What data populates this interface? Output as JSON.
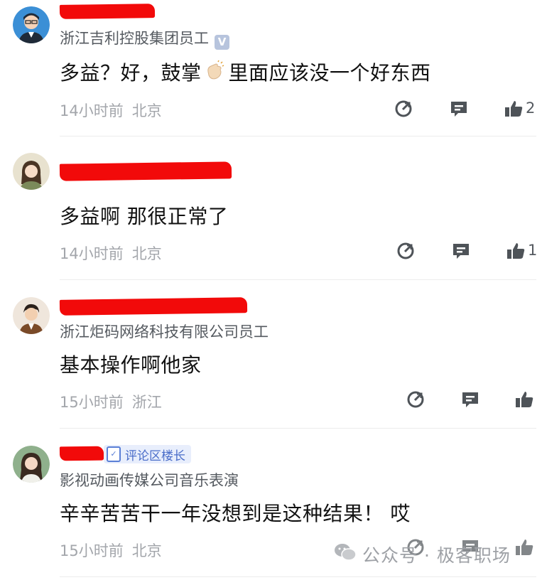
{
  "comments": [
    {
      "company": "浙江吉利控股集团员工",
      "verified": true,
      "text": "多益？好，鼓掌",
      "text_after_emoji": "里面应该没一个好东西",
      "time": "14小时前",
      "location": "北京",
      "likes": "2"
    },
    {
      "company": "",
      "verified": false,
      "text": "多益啊 那很正常了",
      "time": "14小时前",
      "location": "北京",
      "likes": "1"
    },
    {
      "company": "浙江炬码网络科技有限公司员工",
      "verified": false,
      "text": "基本操作啊他家",
      "time": "15小时前",
      "location": "浙江",
      "likes": ""
    },
    {
      "company": "影视动画传媒公司音乐表演",
      "verified": false,
      "badge": "评论区楼长",
      "text": "辛辛苦苦干一年没想到是这种结果！ 哎",
      "time": "15小时前",
      "location": "北京",
      "likes": ""
    }
  ],
  "watermark": {
    "text": "公众号 · 极客职场",
    "icon": "wechat-icon"
  },
  "icons": {
    "reply": "share-arrow-icon",
    "comment": "message-icon",
    "like": "thumbs-up-icon"
  },
  "colors": {
    "redaction": "#f20a0a",
    "meta": "#a3a6ab",
    "badge_bg": "#e8eefc",
    "badge_text": "#4a6dc9",
    "icon": "#4e5358"
  }
}
